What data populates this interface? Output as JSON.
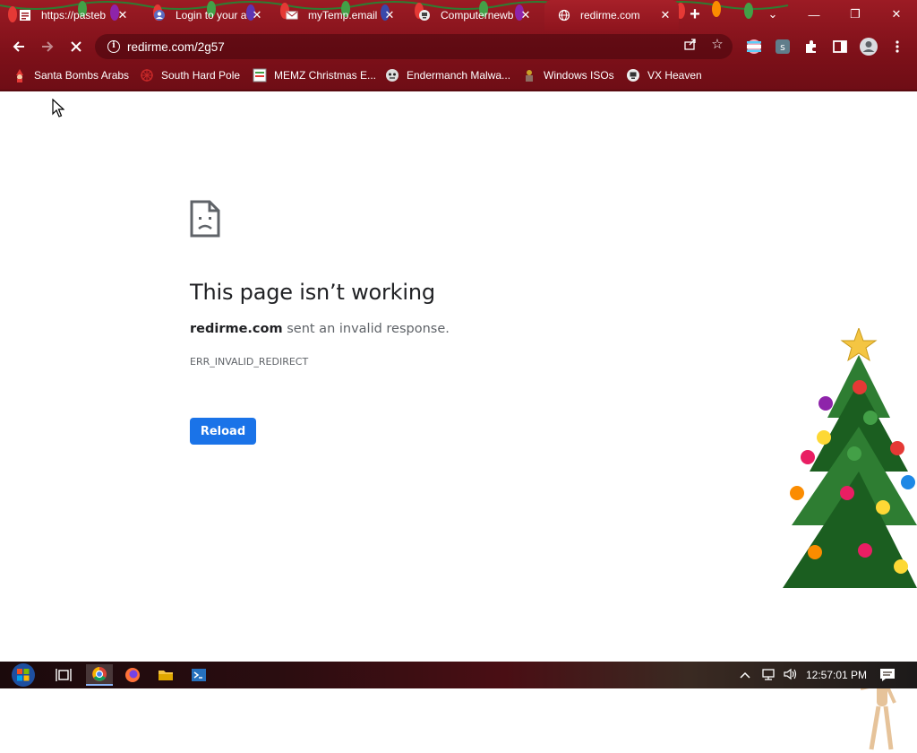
{
  "browser": {
    "tabs": [
      {
        "title": "https://pasteb",
        "favicon": "pastebin-icon",
        "active": false
      },
      {
        "title": "Login to your a",
        "favicon": "login-icon",
        "active": false
      },
      {
        "title": "myTemp.email",
        "favicon": "mytemp-icon",
        "active": false
      },
      {
        "title": "Computernewb",
        "favicon": "computernewb-icon",
        "active": false
      },
      {
        "title": "redirme.com",
        "favicon": "globe-icon",
        "active": true
      }
    ],
    "new_tab_label": "+",
    "window_controls": {
      "dropdown": "⌄",
      "minimize": "—",
      "restore": "❐",
      "close": "✕"
    },
    "address": "redirme.com/2g57",
    "bookmarks": [
      {
        "label": "Santa Bombs Arabs",
        "icon": "santa-icon"
      },
      {
        "label": "South Hard Pole",
        "icon": "snowflake-icon"
      },
      {
        "label": "MEMZ Christmas E...",
        "icon": "memz-icon"
      },
      {
        "label": "Endermanch Malwa...",
        "icon": "endermanch-icon"
      },
      {
        "label": "Windows ISOs",
        "icon": "windows-iso-icon"
      },
      {
        "label": "VX Heaven",
        "icon": "vx-heaven-icon"
      }
    ]
  },
  "error_page": {
    "title": "This page isn’t working",
    "domain": "redirme.com",
    "description": " sent an invalid response.",
    "code": "ERR_INVALID_REDIRECT",
    "reload_label": "Reload"
  },
  "taskbar": {
    "clock": "12:57:01 PM",
    "apps": [
      "task-view-icon",
      "chrome-icon",
      "firefox-icon",
      "file-explorer-icon",
      "powershell-icon"
    ]
  },
  "colors": {
    "chrome_bg": "#8e141d",
    "accent_button": "#1a73e8",
    "title_text": "#202124",
    "body_text": "#5f6368"
  }
}
